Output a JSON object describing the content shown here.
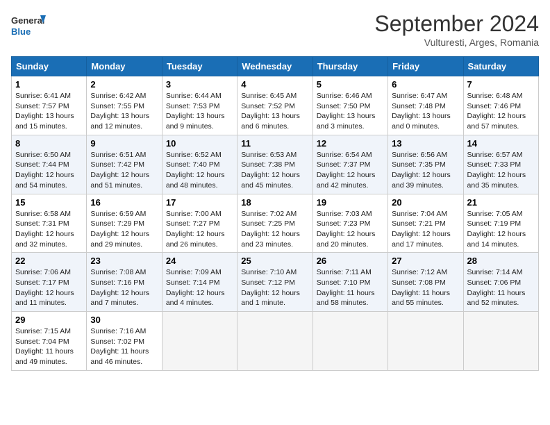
{
  "header": {
    "logo_line1": "General",
    "logo_line2": "Blue",
    "month": "September 2024",
    "location": "Vulturesti, Arges, Romania"
  },
  "weekdays": [
    "Sunday",
    "Monday",
    "Tuesday",
    "Wednesday",
    "Thursday",
    "Friday",
    "Saturday"
  ],
  "weeks": [
    [
      {
        "day": "1",
        "info": "Sunrise: 6:41 AM\nSunset: 7:57 PM\nDaylight: 13 hours\nand 15 minutes."
      },
      {
        "day": "2",
        "info": "Sunrise: 6:42 AM\nSunset: 7:55 PM\nDaylight: 13 hours\nand 12 minutes."
      },
      {
        "day": "3",
        "info": "Sunrise: 6:44 AM\nSunset: 7:53 PM\nDaylight: 13 hours\nand 9 minutes."
      },
      {
        "day": "4",
        "info": "Sunrise: 6:45 AM\nSunset: 7:52 PM\nDaylight: 13 hours\nand 6 minutes."
      },
      {
        "day": "5",
        "info": "Sunrise: 6:46 AM\nSunset: 7:50 PM\nDaylight: 13 hours\nand 3 minutes."
      },
      {
        "day": "6",
        "info": "Sunrise: 6:47 AM\nSunset: 7:48 PM\nDaylight: 13 hours\nand 0 minutes."
      },
      {
        "day": "7",
        "info": "Sunrise: 6:48 AM\nSunset: 7:46 PM\nDaylight: 12 hours\nand 57 minutes."
      }
    ],
    [
      {
        "day": "8",
        "info": "Sunrise: 6:50 AM\nSunset: 7:44 PM\nDaylight: 12 hours\nand 54 minutes."
      },
      {
        "day": "9",
        "info": "Sunrise: 6:51 AM\nSunset: 7:42 PM\nDaylight: 12 hours\nand 51 minutes."
      },
      {
        "day": "10",
        "info": "Sunrise: 6:52 AM\nSunset: 7:40 PM\nDaylight: 12 hours\nand 48 minutes."
      },
      {
        "day": "11",
        "info": "Sunrise: 6:53 AM\nSunset: 7:38 PM\nDaylight: 12 hours\nand 45 minutes."
      },
      {
        "day": "12",
        "info": "Sunrise: 6:54 AM\nSunset: 7:37 PM\nDaylight: 12 hours\nand 42 minutes."
      },
      {
        "day": "13",
        "info": "Sunrise: 6:56 AM\nSunset: 7:35 PM\nDaylight: 12 hours\nand 39 minutes."
      },
      {
        "day": "14",
        "info": "Sunrise: 6:57 AM\nSunset: 7:33 PM\nDaylight: 12 hours\nand 35 minutes."
      }
    ],
    [
      {
        "day": "15",
        "info": "Sunrise: 6:58 AM\nSunset: 7:31 PM\nDaylight: 12 hours\nand 32 minutes."
      },
      {
        "day": "16",
        "info": "Sunrise: 6:59 AM\nSunset: 7:29 PM\nDaylight: 12 hours\nand 29 minutes."
      },
      {
        "day": "17",
        "info": "Sunrise: 7:00 AM\nSunset: 7:27 PM\nDaylight: 12 hours\nand 26 minutes."
      },
      {
        "day": "18",
        "info": "Sunrise: 7:02 AM\nSunset: 7:25 PM\nDaylight: 12 hours\nand 23 minutes."
      },
      {
        "day": "19",
        "info": "Sunrise: 7:03 AM\nSunset: 7:23 PM\nDaylight: 12 hours\nand 20 minutes."
      },
      {
        "day": "20",
        "info": "Sunrise: 7:04 AM\nSunset: 7:21 PM\nDaylight: 12 hours\nand 17 minutes."
      },
      {
        "day": "21",
        "info": "Sunrise: 7:05 AM\nSunset: 7:19 PM\nDaylight: 12 hours\nand 14 minutes."
      }
    ],
    [
      {
        "day": "22",
        "info": "Sunrise: 7:06 AM\nSunset: 7:17 PM\nDaylight: 12 hours\nand 11 minutes."
      },
      {
        "day": "23",
        "info": "Sunrise: 7:08 AM\nSunset: 7:16 PM\nDaylight: 12 hours\nand 7 minutes."
      },
      {
        "day": "24",
        "info": "Sunrise: 7:09 AM\nSunset: 7:14 PM\nDaylight: 12 hours\nand 4 minutes."
      },
      {
        "day": "25",
        "info": "Sunrise: 7:10 AM\nSunset: 7:12 PM\nDaylight: 12 hours\nand 1 minute."
      },
      {
        "day": "26",
        "info": "Sunrise: 7:11 AM\nSunset: 7:10 PM\nDaylight: 11 hours\nand 58 minutes."
      },
      {
        "day": "27",
        "info": "Sunrise: 7:12 AM\nSunset: 7:08 PM\nDaylight: 11 hours\nand 55 minutes."
      },
      {
        "day": "28",
        "info": "Sunrise: 7:14 AM\nSunset: 7:06 PM\nDaylight: 11 hours\nand 52 minutes."
      }
    ],
    [
      {
        "day": "29",
        "info": "Sunrise: 7:15 AM\nSunset: 7:04 PM\nDaylight: 11 hours\nand 49 minutes."
      },
      {
        "day": "30",
        "info": "Sunrise: 7:16 AM\nSunset: 7:02 PM\nDaylight: 11 hours\nand 46 minutes."
      },
      {
        "day": "",
        "info": ""
      },
      {
        "day": "",
        "info": ""
      },
      {
        "day": "",
        "info": ""
      },
      {
        "day": "",
        "info": ""
      },
      {
        "day": "",
        "info": ""
      }
    ]
  ]
}
